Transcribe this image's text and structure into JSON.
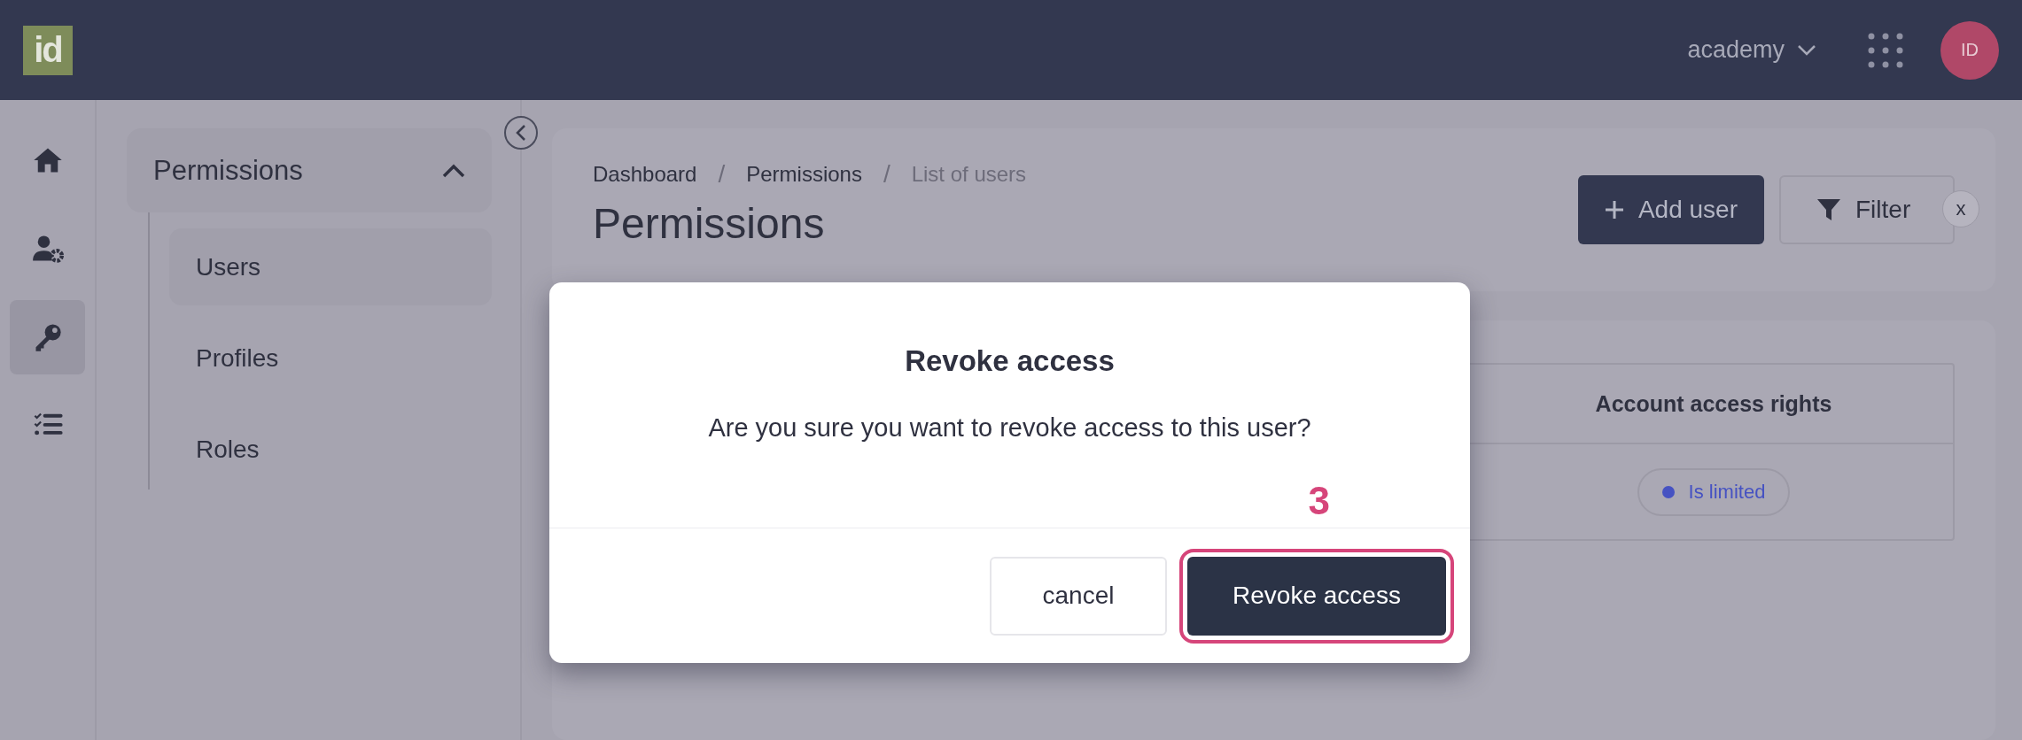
{
  "top_bar": {
    "logo": "id",
    "workspace": "academy",
    "avatar": "ID"
  },
  "rail": {
    "items": [
      {
        "kind": "home",
        "selected": false
      },
      {
        "kind": "user-settings",
        "selected": false
      },
      {
        "kind": "key",
        "selected": true
      },
      {
        "kind": "checklist",
        "selected": false
      }
    ]
  },
  "sidebar": {
    "section": {
      "label": "Permissions",
      "expanded": true,
      "children": [
        {
          "label": "Users",
          "selected": true
        },
        {
          "label": "Profiles",
          "selected": false
        },
        {
          "label": "Roles",
          "selected": false
        }
      ]
    }
  },
  "breadcrumb": {
    "separator": "/",
    "items": [
      {
        "label": "Dashboard",
        "current": false
      },
      {
        "label": "Permissions",
        "current": false
      },
      {
        "label": "List of users",
        "current": true
      }
    ]
  },
  "page_title": "Permissions",
  "actions": [
    {
      "kind": "add",
      "label": "Add user"
    },
    {
      "kind": "filter",
      "label": "Filter"
    }
  ],
  "filter_clear": "x",
  "table": {
    "columns": [
      "Account access rights"
    ],
    "rows": [
      {
        "status": {
          "label": "Is limited",
          "color": "#4652c2"
        }
      }
    ]
  },
  "dialog": {
    "title": "Revoke access",
    "message": "Are you sure you want to revoke access to this user?",
    "buttons": [
      {
        "kind": "secondary",
        "label": "cancel",
        "highlighted": false
      },
      {
        "kind": "primary",
        "label": "Revoke access",
        "highlighted": true
      }
    ]
  },
  "annotation": {
    "label": "3"
  }
}
